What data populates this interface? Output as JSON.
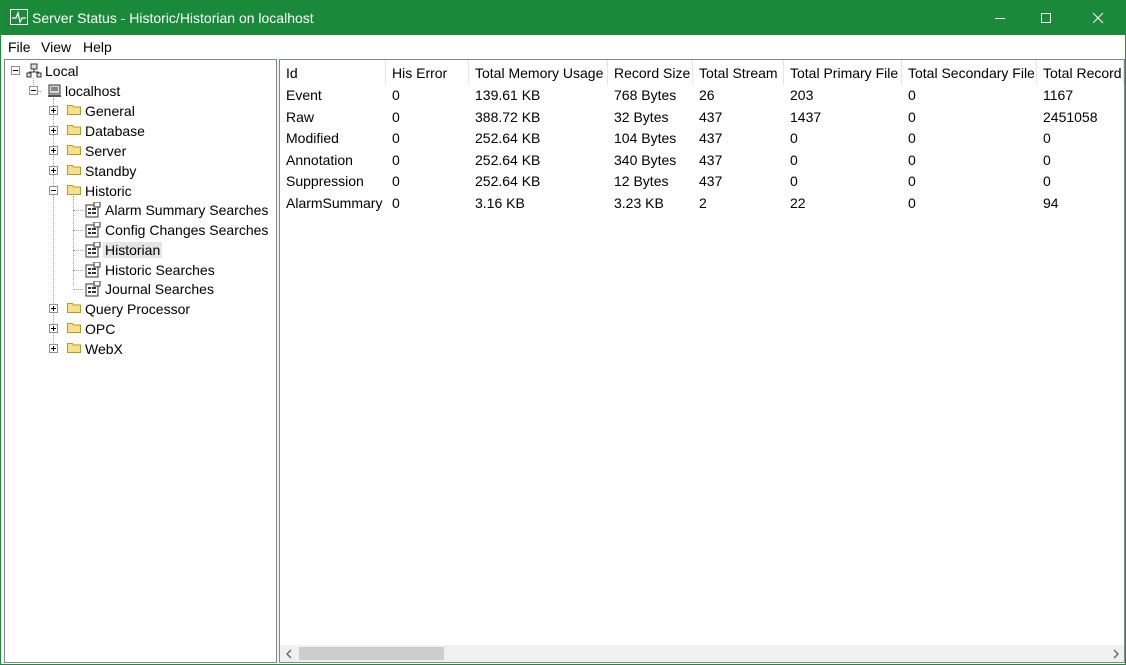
{
  "window": {
    "title": "Server Status - Historic/Historian on localhost",
    "accent": "#1a8a3a"
  },
  "menu": {
    "items": [
      "File",
      "View",
      "Help"
    ]
  },
  "tree": {
    "root": "Local",
    "host": "localhost",
    "folders": [
      "General",
      "Database",
      "Server",
      "Standby",
      "Historic"
    ],
    "historic_children": [
      "Alarm Summary Searches",
      "Config Changes Searches",
      "Historian",
      "Historic Searches",
      "Journal Searches"
    ],
    "selected": "Historian",
    "folders_after": [
      "Query Processor",
      "OPC",
      "WebX"
    ]
  },
  "table": {
    "columns": [
      "Id",
      "His Error",
      "Total Memory Usage",
      "Record Size",
      "Total Stream",
      "Total Primary File",
      "Total Secondary File",
      "Total Record"
    ],
    "rows": [
      [
        "Event",
        "0",
        "139.61 KB",
        "768 Bytes",
        "26",
        "203",
        "0",
        "1167"
      ],
      [
        "Raw",
        "0",
        "388.72 KB",
        "32 Bytes",
        "437",
        "1437",
        "0",
        "2451058"
      ],
      [
        "Modified",
        "0",
        "252.64 KB",
        "104 Bytes",
        "437",
        "0",
        "0",
        "0"
      ],
      [
        "Annotation",
        "0",
        "252.64 KB",
        "340 Bytes",
        "437",
        "0",
        "0",
        "0"
      ],
      [
        "Suppression",
        "0",
        "252.64 KB",
        "12 Bytes",
        "437",
        "0",
        "0",
        "0"
      ],
      [
        "AlarmSummary",
        "0",
        "3.16 KB",
        "3.23 KB",
        "2",
        "22",
        "0",
        "94"
      ]
    ]
  },
  "scrollbar": {
    "position_fraction": 0.0,
    "visible_fraction": 0.18
  }
}
